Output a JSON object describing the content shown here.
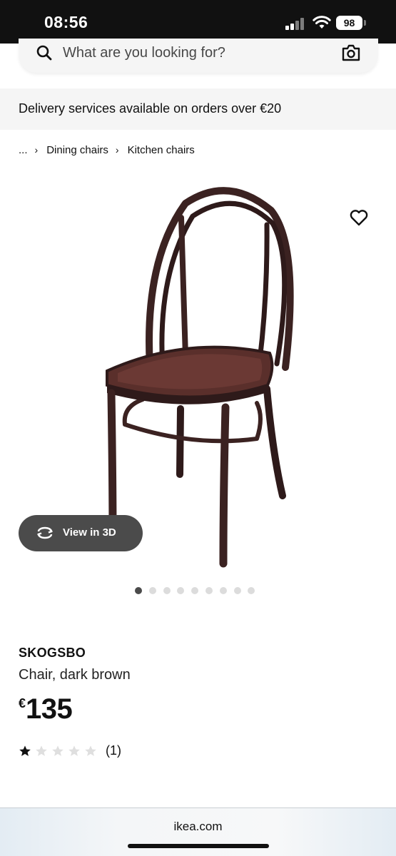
{
  "status_bar": {
    "time": "08:56",
    "battery": "98"
  },
  "search": {
    "placeholder": "What are you looking for?"
  },
  "delivery": {
    "text": "Delivery services available on orders over €20"
  },
  "breadcrumb": {
    "ellipsis": "...",
    "items": [
      "Dining chairs",
      "Kitchen chairs"
    ]
  },
  "gallery": {
    "view3d_label": "View in 3D",
    "image_count": 9,
    "active_index": 0
  },
  "product": {
    "name": "SKOGSBO",
    "description": "Chair, dark brown",
    "price_currency": "€",
    "price_amount": "135",
    "rating": 1,
    "rating_max": 5,
    "review_count": "(1)"
  },
  "browser": {
    "url": "ikea.com"
  },
  "icons": [
    "search-icon",
    "camera-icon",
    "heart-icon",
    "rotate-3d-icon",
    "star-icon",
    "wifi-icon",
    "signal-icon",
    "battery-icon"
  ],
  "colors": {
    "chair": "#3b2221",
    "button_dark": "#4b4b4b",
    "banner_bg": "#f5f5f5"
  }
}
